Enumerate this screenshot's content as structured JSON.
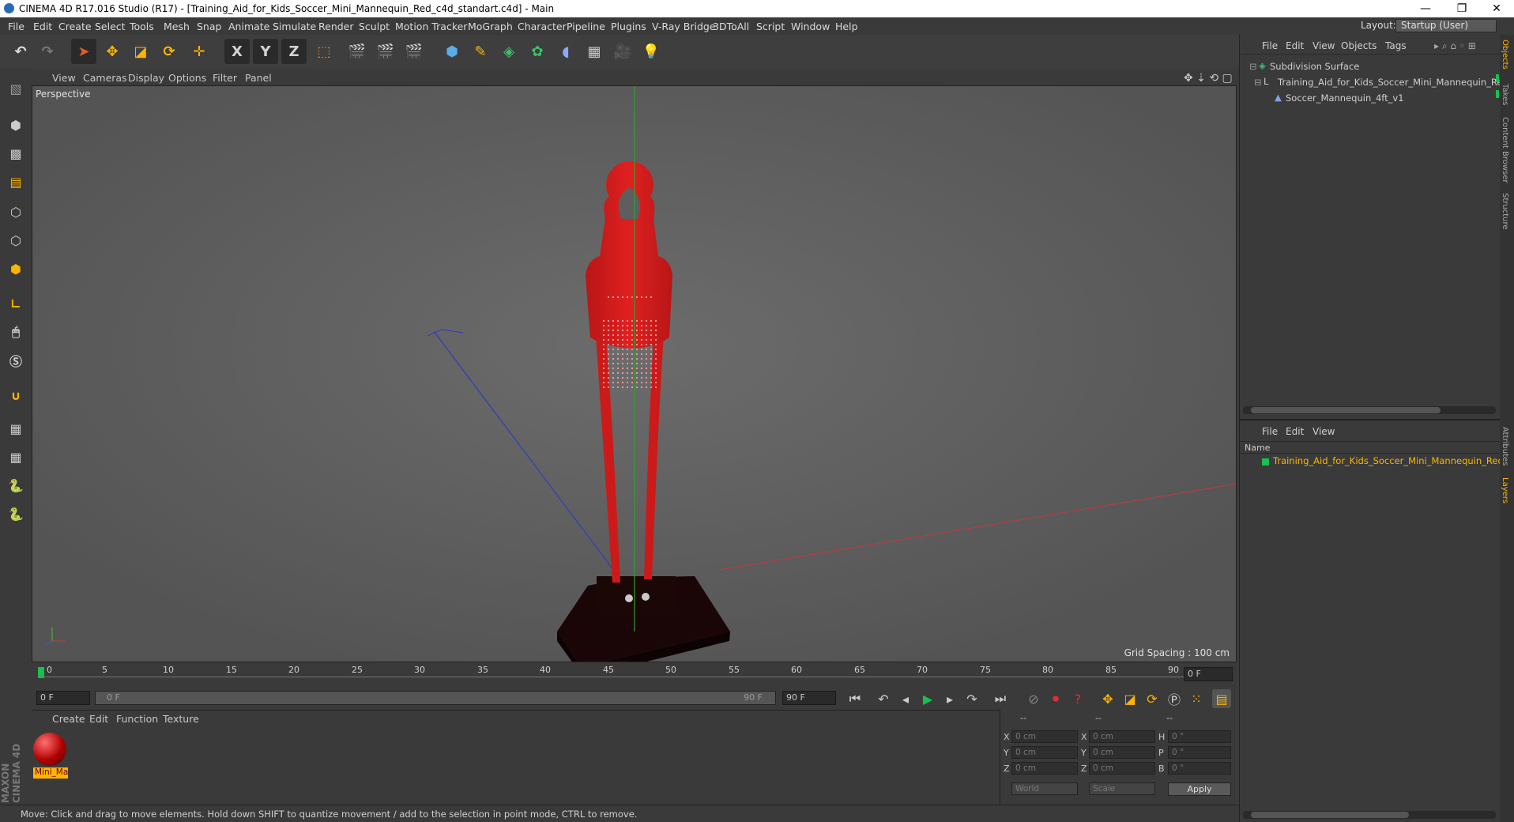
{
  "window": {
    "title": "CINEMA 4D R17.016 Studio (R17) - [Training_Aid_for_Kids_Soccer_Mini_Mannequin_Red_c4d_standart.c4d] - Main",
    "minimize": "—",
    "restore": "❐",
    "close": "✕"
  },
  "menu": [
    "File",
    "Edit",
    "Create",
    "Select",
    "Tools",
    "Mesh",
    "Snap",
    "Animate",
    "Simulate",
    "Render",
    "Sculpt",
    "Motion Tracker",
    "MoGraph",
    "Character",
    "Pipeline",
    "Plugins",
    "V-Ray Bridge",
    "3DToAll",
    "Script",
    "Window",
    "Help"
  ],
  "layout": {
    "label": "Layout:",
    "value": "Startup (User)"
  },
  "toolbar": {
    "x": "X",
    "y": "Y",
    "z": "Z"
  },
  "viewport": {
    "menu": [
      "View",
      "Cameras",
      "Display",
      "Options",
      "Filter",
      "Panel"
    ],
    "label": "Perspective",
    "grid_spacing": "Grid Spacing : 100 cm"
  },
  "timeline": {
    "ticks": [
      "0",
      "5",
      "10",
      "15",
      "20",
      "25",
      "30",
      "35",
      "40",
      "45",
      "50",
      "55",
      "60",
      "65",
      "70",
      "75",
      "80",
      "85",
      "90"
    ],
    "current": "0 F",
    "start": "0 F",
    "range_start": "0 F",
    "range_end": "90 F",
    "end": "90 F"
  },
  "material": {
    "menu": [
      "Create",
      "Edit",
      "Function",
      "Texture"
    ],
    "name": "Mini_Ma"
  },
  "coords": {
    "headers": [
      "--",
      "--",
      "--"
    ],
    "rows": [
      {
        "a": "X",
        "av": "0 cm",
        "b": "X",
        "bv": "0 cm",
        "c": "H",
        "cv": "0 °"
      },
      {
        "a": "Y",
        "av": "0 cm",
        "b": "Y",
        "bv": "0 cm",
        "c": "P",
        "cv": "0 °"
      },
      {
        "a": "Z",
        "av": "0 cm",
        "b": "Z",
        "bv": "0 cm",
        "c": "B",
        "cv": "0 °"
      }
    ],
    "world": "World",
    "scale": "Scale",
    "apply": "Apply"
  },
  "status": "Move: Click and drag to move elements. Hold down SHIFT to quantize movement / add to the selection in point mode, CTRL to remove.",
  "objects": {
    "menu": [
      "File",
      "Edit",
      "View",
      "Objects",
      "Tags"
    ],
    "tree": [
      "Subdivision Surface",
      "Training_Aid_for_Kids_Soccer_Mini_Mannequin_Red",
      "Soccer_Mannequin_4ft_v1"
    ]
  },
  "layers": {
    "menu": [
      "File",
      "Edit",
      "View"
    ],
    "col": "Name",
    "item": "Training_Aid_for_Kids_Soccer_Mini_Mannequin_Red"
  },
  "side_tabs": [
    "Objects",
    "Takes",
    "Content Browser",
    "Structure",
    "Attributes",
    "Layers"
  ],
  "maxon": [
    "MAXON",
    "CINEMA 4D"
  ]
}
